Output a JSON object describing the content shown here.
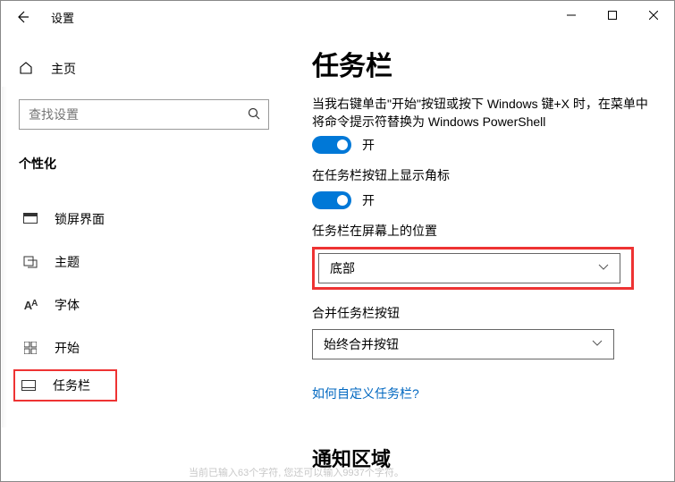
{
  "window": {
    "title": "设置",
    "min": "—",
    "max": "□",
    "close": "✕"
  },
  "sidebar": {
    "home_label": "主页",
    "search_placeholder": "查找设置",
    "section": "个性化",
    "items": [
      {
        "label": "锁屏界面"
      },
      {
        "label": "主题"
      },
      {
        "label": "字体"
      },
      {
        "label": "开始"
      },
      {
        "label": "任务栏"
      }
    ]
  },
  "content": {
    "title": "任务栏",
    "powershell_desc": "当我右键单击\"开始\"按钮或按下 Windows 键+X 时，在菜单中将命令提示符替换为 Windows PowerShell",
    "toggle1_state": "开",
    "badges_label": "在任务栏按钮上显示角标",
    "toggle2_state": "开",
    "position_label": "任务栏在屏幕上的位置",
    "position_value": "底部",
    "combine_label": "合并任务栏按钮",
    "combine_value": "始终合并按钮",
    "customize_link": "如何自定义任务栏?",
    "notification_heading": "通知区域"
  },
  "footer": "当前已输入63个字符, 您还可以输入9937个字符。"
}
